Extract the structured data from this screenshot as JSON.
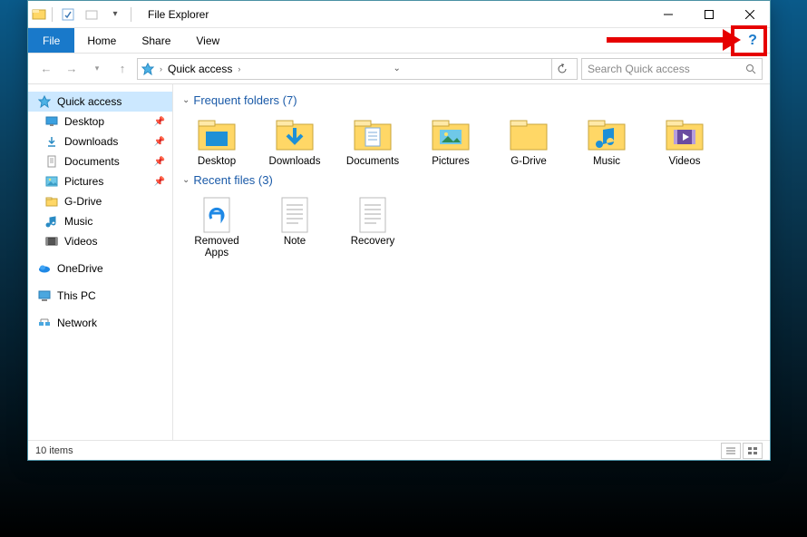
{
  "window": {
    "title": "File Explorer"
  },
  "ribbon": {
    "file": "File",
    "tabs": [
      "Home",
      "Share",
      "View"
    ]
  },
  "nav": {
    "breadcrumb_root_icon": "quick-access-star",
    "breadcrumb": "Quick access",
    "search_placeholder": "Search Quick access"
  },
  "sidebar": {
    "quick_access": "Quick access",
    "items": [
      {
        "label": "Desktop",
        "icon": "desktop",
        "pinned": true
      },
      {
        "label": "Downloads",
        "icon": "downloads",
        "pinned": true
      },
      {
        "label": "Documents",
        "icon": "documents",
        "pinned": true
      },
      {
        "label": "Pictures",
        "icon": "pictures",
        "pinned": true
      },
      {
        "label": "G-Drive",
        "icon": "folder",
        "pinned": false
      },
      {
        "label": "Music",
        "icon": "music",
        "pinned": false
      },
      {
        "label": "Videos",
        "icon": "videos",
        "pinned": false
      }
    ],
    "onedrive": "OneDrive",
    "thispc": "This PC",
    "network": "Network"
  },
  "groups": {
    "frequent": {
      "label": "Frequent folders",
      "count": 7
    },
    "recent": {
      "label": "Recent files",
      "count": 3
    }
  },
  "frequent_items": [
    {
      "label": "Desktop",
      "icon": "desktop-big"
    },
    {
      "label": "Downloads",
      "icon": "downloads-big"
    },
    {
      "label": "Documents",
      "icon": "documents-big"
    },
    {
      "label": "Pictures",
      "icon": "pictures-big"
    },
    {
      "label": "G-Drive",
      "icon": "folder-big"
    },
    {
      "label": "Music",
      "icon": "music-big"
    },
    {
      "label": "Videos",
      "icon": "videos-big"
    }
  ],
  "recent_items": [
    {
      "label": "Removed Apps",
      "icon": "edge-file"
    },
    {
      "label": "Note",
      "icon": "text-file"
    },
    {
      "label": "Recovery",
      "icon": "text-file"
    }
  ],
  "status": {
    "item_count_label": "10 items"
  }
}
